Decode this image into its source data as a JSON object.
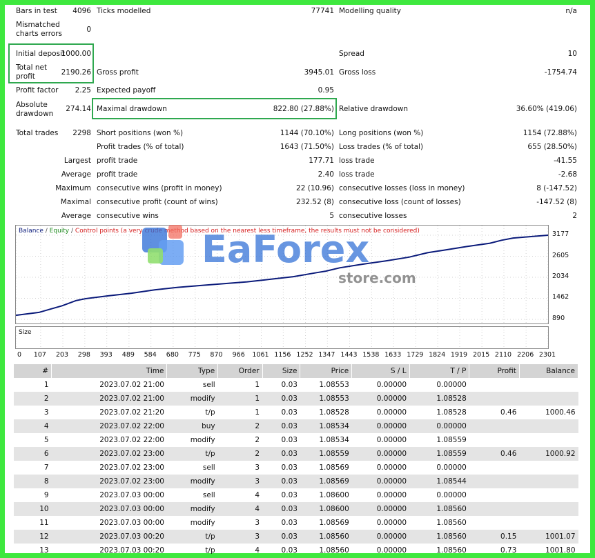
{
  "stats": {
    "bars_label": "Bars in test",
    "bars_value": "4096",
    "ticks_label": "Ticks modelled",
    "ticks_value": "77741",
    "quality_label": "Modelling quality",
    "quality_value": "n/a",
    "mismatch_label1": "Mismatched",
    "mismatch_label2": "charts errors",
    "mismatch_value": "0",
    "deposit_label": "Initial deposit",
    "deposit_value": "1000.00",
    "spread_label": "Spread",
    "spread_value": "10",
    "net_label1": "Total net",
    "net_label2": "profit",
    "net_value": "2190.26",
    "gross_profit_label": "Gross profit",
    "gross_profit_value": "3945.01",
    "gross_loss_label": "Gross loss",
    "gross_loss_value": "-1754.74",
    "pf_label": "Profit factor",
    "pf_value": "2.25",
    "payoff_label": "Expected payoff",
    "payoff_value": "0.95",
    "absdd_label1": "Absolute",
    "absdd_label2": "drawdown",
    "absdd_value": "274.14",
    "maxdd_label": "Maximal drawdown",
    "maxdd_value": "822.80 (27.88%)",
    "reldd_label": "Relative drawdown",
    "reldd_value": "36.60% (419.06)",
    "trades_label": "Total trades",
    "trades_value": "2298",
    "short_label": "Short positions (won %)",
    "short_value": "1144 (70.10%)",
    "long_label": "Long positions (won %)",
    "long_value": "1154 (72.88%)",
    "ptrades_label": "Profit trades (% of total)",
    "ptrades_value": "1643 (71.50%)",
    "ltrades_label": "Loss trades (% of total)",
    "ltrades_value": "655 (28.50%)",
    "largest": "Largest",
    "average": "Average",
    "maximum": "Maximum",
    "maximal": "Maximal",
    "lpt_label": "profit trade",
    "lpt_value": "177.71",
    "llt_label": "loss trade",
    "llt_value": "-41.55",
    "apt_label": "profit trade",
    "apt_value": "2.40",
    "alt_label": "loss trade",
    "alt_value": "-2.68",
    "mcw_label": "consecutive wins (profit in money)",
    "mcw_value": "22 (10.96)",
    "mcl_label": "consecutive losses (loss in money)",
    "mcl_value": "8 (-147.52)",
    "mcp_label": "consecutive profit (count of wins)",
    "mcp_value": "232.52 (8)",
    "mcls_label": "consecutive loss (count of losses)",
    "mcls_value": "-147.52 (8)",
    "acw_label": "consecutive wins",
    "acw_value": "5",
    "acl_label": "consecutive losses",
    "acl_value": "2"
  },
  "watermark": {
    "line1": "EaForex",
    "line2": "store.com"
  },
  "chart_data": {
    "type": "line",
    "legend": {
      "balance": "Balance",
      "sep1": " / ",
      "equity": "Equity",
      "sep2": " / ",
      "control": "Control points (a very crude method based on the nearest less timeframe, the results must not be considered)"
    },
    "y_ticks": [
      "3177",
      "2605",
      "2034",
      "1462",
      "890"
    ],
    "ylim": [
      890,
      3177
    ],
    "x_ticks": [
      "0",
      "107",
      "203",
      "298",
      "393",
      "489",
      "584",
      "680",
      "775",
      "870",
      "966",
      "1061",
      "1156",
      "1252",
      "1347",
      "1443",
      "1538",
      "1633",
      "1729",
      "1824",
      "1919",
      "2015",
      "2110",
      "2206",
      "2301"
    ],
    "xlim": [
      0,
      2301
    ],
    "size_label": "Size",
    "series": [
      {
        "name": "Balance",
        "color": "#0a1a7a",
        "x": [
          0,
          100,
          150,
          200,
          260,
          300,
          400,
          500,
          600,
          700,
          800,
          900,
          1000,
          1100,
          1200,
          1300,
          1340,
          1400,
          1500,
          1600,
          1700,
          1780,
          1850,
          1950,
          2050,
          2100,
          2150,
          2250,
          2301
        ],
        "values": [
          1000,
          1080,
          1170,
          1260,
          1400,
          1450,
          1530,
          1600,
          1690,
          1760,
          1810,
          1860,
          1910,
          1980,
          2050,
          2160,
          2200,
          2290,
          2390,
          2480,
          2580,
          2700,
          2770,
          2870,
          2960,
          3040,
          3100,
          3150,
          3177
        ]
      }
    ],
    "colors": {
      "balance": "#0a1a7a",
      "equity": "#1d8a1d",
      "control": "#d61f1f"
    }
  },
  "table": {
    "headers": [
      "#",
      "Time",
      "Type",
      "Order",
      "Size",
      "Price",
      "S / L",
      "T / P",
      "Profit",
      "Balance"
    ],
    "rows": [
      [
        "1",
        "2023.07.02 21:00",
        "sell",
        "1",
        "0.03",
        "1.08553",
        "0.00000",
        "0.00000",
        "",
        ""
      ],
      [
        "2",
        "2023.07.02 21:00",
        "modify",
        "1",
        "0.03",
        "1.08553",
        "0.00000",
        "1.08528",
        "",
        ""
      ],
      [
        "3",
        "2023.07.02 21:20",
        "t/p",
        "1",
        "0.03",
        "1.08528",
        "0.00000",
        "1.08528",
        "0.46",
        "1000.46"
      ],
      [
        "4",
        "2023.07.02 22:00",
        "buy",
        "2",
        "0.03",
        "1.08534",
        "0.00000",
        "0.00000",
        "",
        ""
      ],
      [
        "5",
        "2023.07.02 22:00",
        "modify",
        "2",
        "0.03",
        "1.08534",
        "0.00000",
        "1.08559",
        "",
        ""
      ],
      [
        "6",
        "2023.07.02 23:00",
        "t/p",
        "2",
        "0.03",
        "1.08559",
        "0.00000",
        "1.08559",
        "0.46",
        "1000.92"
      ],
      [
        "7",
        "2023.07.02 23:00",
        "sell",
        "3",
        "0.03",
        "1.08569",
        "0.00000",
        "0.00000",
        "",
        ""
      ],
      [
        "8",
        "2023.07.02 23:00",
        "modify",
        "3",
        "0.03",
        "1.08569",
        "0.00000",
        "1.08544",
        "",
        ""
      ],
      [
        "9",
        "2023.07.03 00:00",
        "sell",
        "4",
        "0.03",
        "1.08600",
        "0.00000",
        "0.00000",
        "",
        ""
      ],
      [
        "10",
        "2023.07.03 00:00",
        "modify",
        "4",
        "0.03",
        "1.08600",
        "0.00000",
        "1.08560",
        "",
        ""
      ],
      [
        "11",
        "2023.07.03 00:00",
        "modify",
        "3",
        "0.03",
        "1.08569",
        "0.00000",
        "1.08560",
        "",
        ""
      ],
      [
        "12",
        "2023.07.03 00:20",
        "t/p",
        "3",
        "0.03",
        "1.08560",
        "0.00000",
        "1.08560",
        "0.15",
        "1001.07"
      ],
      [
        "13",
        "2023.07.03 00:20",
        "t/p",
        "4",
        "0.03",
        "1.08560",
        "0.00000",
        "1.08560",
        "0.73",
        "1001.80"
      ]
    ]
  }
}
